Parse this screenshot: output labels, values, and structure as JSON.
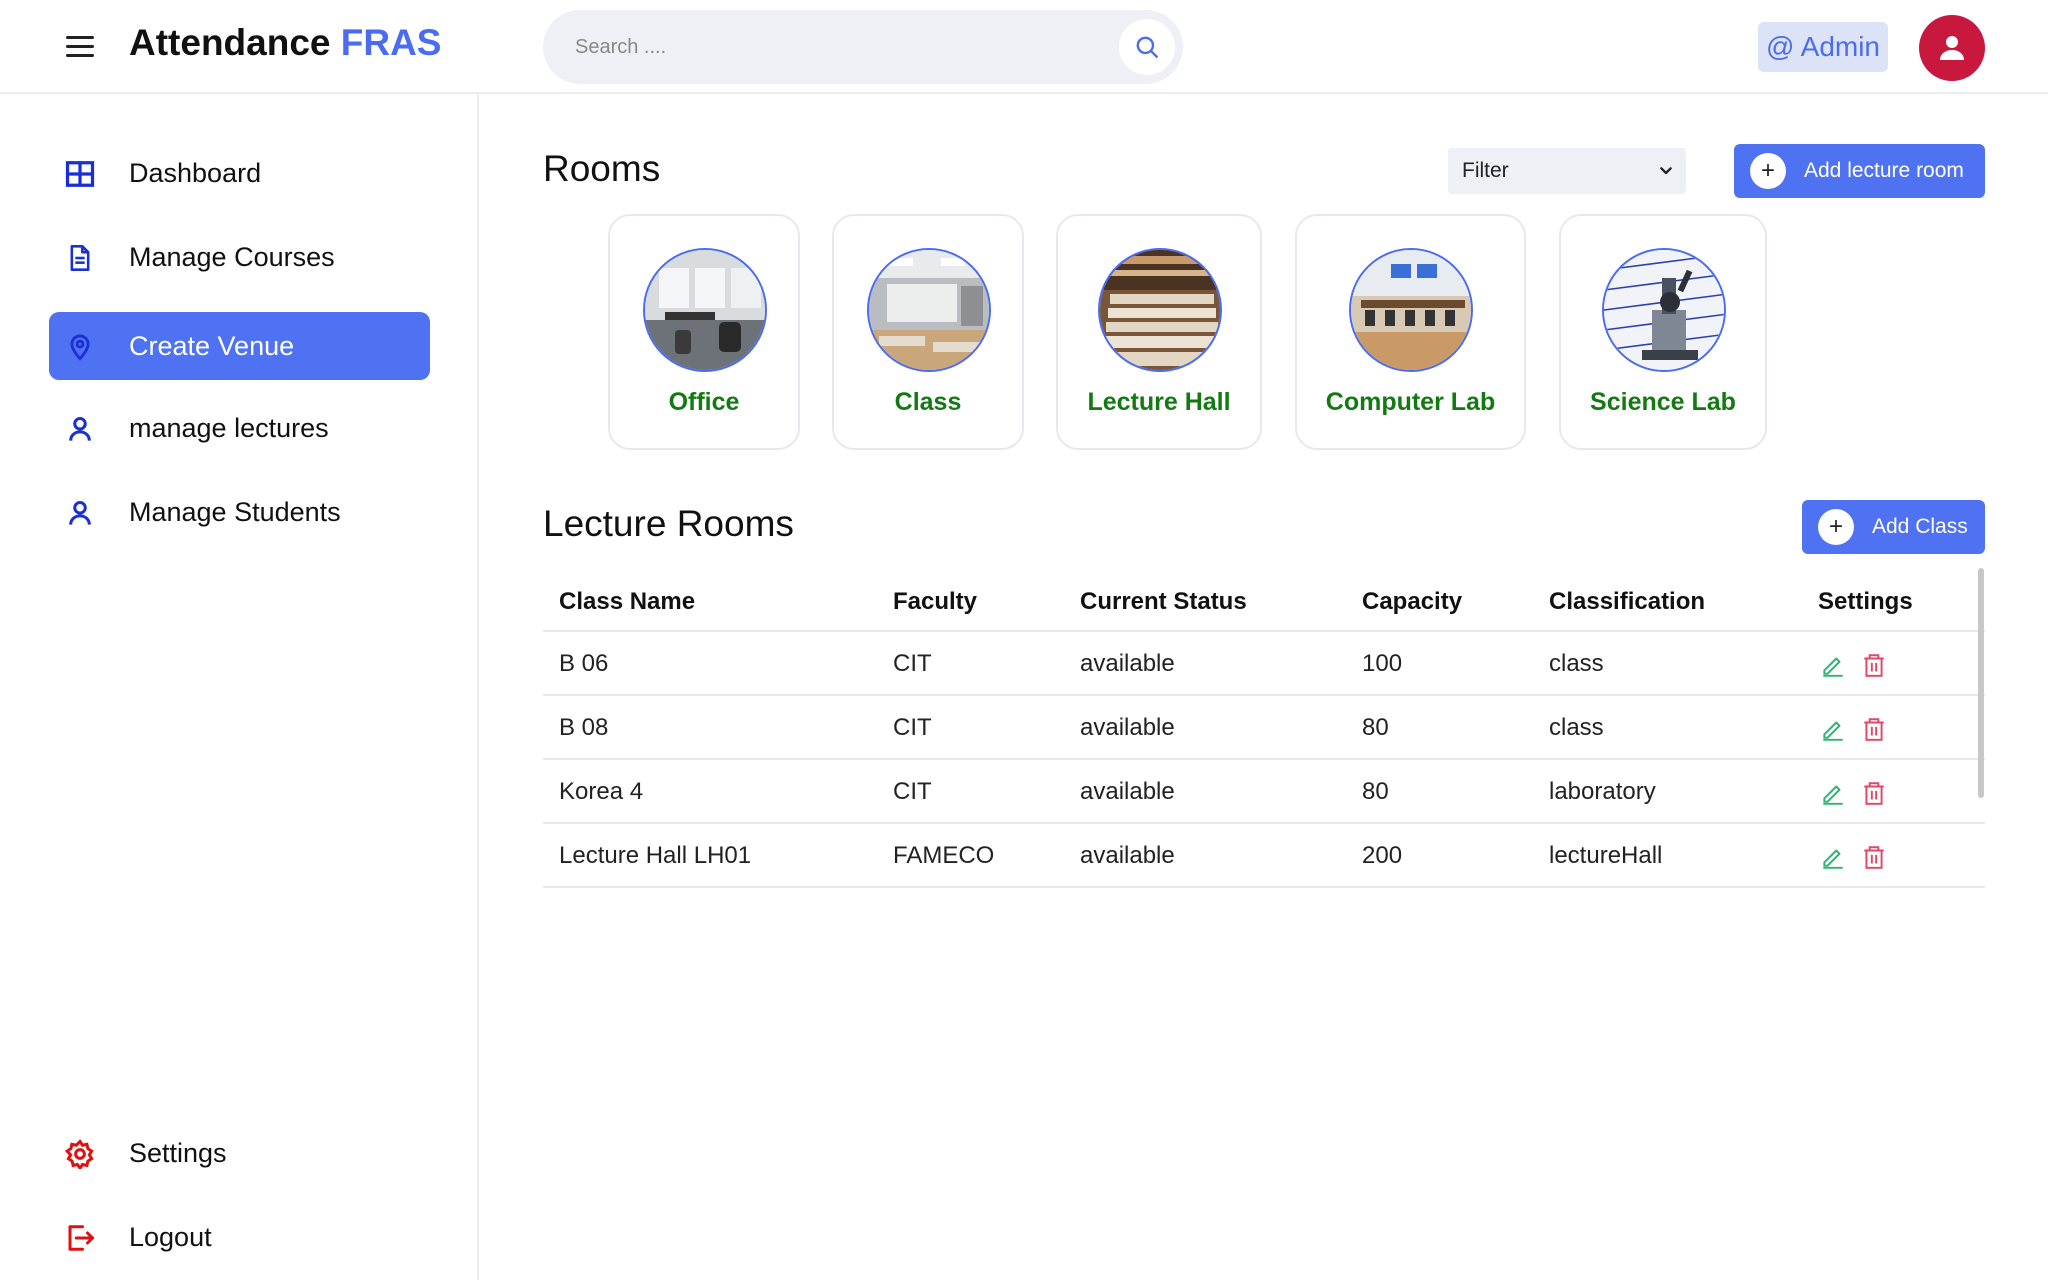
{
  "header": {
    "brand_main": "Attendance",
    "brand_accent": "FRAS",
    "search_placeholder": "Search ....",
    "admin_label": "@ Admin"
  },
  "sidebar": {
    "items": [
      {
        "label": "Dashboard",
        "icon": "grid-icon",
        "active": false
      },
      {
        "label": "Manage Courses",
        "icon": "document-icon",
        "active": false
      },
      {
        "label": "Create Venue",
        "icon": "map-pin-icon",
        "active": true
      },
      {
        "label": "manage lectures",
        "icon": "user-icon",
        "active": false
      },
      {
        "label": "Manage Students",
        "icon": "user-icon",
        "active": false
      }
    ],
    "bottom_items": [
      {
        "label": "Settings",
        "icon": "gear-icon"
      },
      {
        "label": "Logout",
        "icon": "logout-icon"
      }
    ]
  },
  "rooms": {
    "title": "Rooms",
    "filter_label": "Filter",
    "add_button": "Add lecture room",
    "cards": [
      {
        "label": "Office"
      },
      {
        "label": "Class"
      },
      {
        "label": "Lecture Hall"
      },
      {
        "label": "Computer Lab"
      },
      {
        "label": "Science Lab"
      }
    ]
  },
  "lecture_rooms": {
    "title": "Lecture Rooms",
    "add_button": "Add Class",
    "columns": [
      "Class Name",
      "Faculty",
      "Current Status",
      "Capacity",
      "Classification",
      "Settings"
    ],
    "rows": [
      {
        "name": "B 06",
        "faculty": "CIT",
        "status": "available",
        "capacity": "100",
        "classification": "class"
      },
      {
        "name": "B 08",
        "faculty": "CIT",
        "status": "available",
        "capacity": "80",
        "classification": "class"
      },
      {
        "name": "Korea 4",
        "faculty": "CIT",
        "status": "available",
        "capacity": "80",
        "classification": "laboratory"
      },
      {
        "name": "Lecture Hall LH01",
        "faculty": "FAMECO",
        "status": "available",
        "capacity": "200",
        "classification": "lectureHall"
      }
    ]
  },
  "colors": {
    "accent": "#4f72f2",
    "brand_accent": "#4b6cf0",
    "room_label": "#137a13",
    "avatar": "#c8183e",
    "edit_icon": "#2bb673",
    "delete_icon": "#e0486a",
    "nav_icon": "#1a2fd6",
    "bottom_icon": "#e01010"
  }
}
